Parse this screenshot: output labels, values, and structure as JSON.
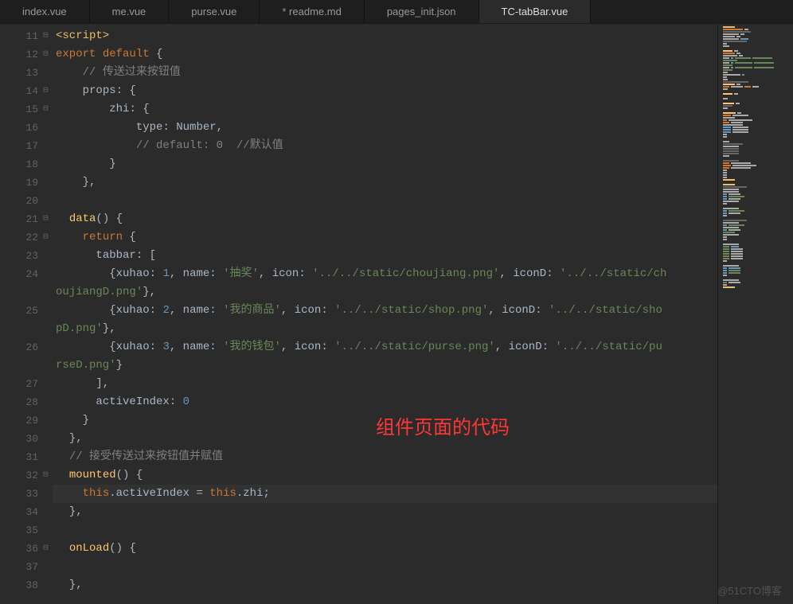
{
  "tabs": [
    {
      "label": "index.vue",
      "active": false
    },
    {
      "label": "me.vue",
      "active": false
    },
    {
      "label": "purse.vue",
      "active": false
    },
    {
      "label": "* readme.md",
      "active": false
    },
    {
      "label": "pages_init.json",
      "active": false
    },
    {
      "label": "TC-tabBar.vue",
      "active": true
    }
  ],
  "lineStart": 11,
  "foldMarks": {
    "11": "⊟",
    "12": "⊟",
    "14": "⊟",
    "15": "⊟",
    "21": "⊟",
    "22": "⊟",
    "32": "⊟",
    "36": "⊟"
  },
  "highlightLine": 33,
  "overlayText": "组件页面的代码",
  "watermark": "@51CTO博客",
  "code": [
    [
      [
        "tag",
        "<script>"
      ]
    ],
    [
      [
        "kw",
        "export"
      ],
      [
        "op",
        " "
      ],
      [
        "kw",
        "default"
      ],
      [
        "op",
        " {"
      ]
    ],
    [
      [
        "op",
        "    "
      ],
      [
        "cm",
        "// 传送过来按钮值"
      ]
    ],
    [
      [
        "op",
        "    "
      ],
      [
        "id",
        "props"
      ],
      [
        "op",
        ": {"
      ]
    ],
    [
      [
        "op",
        "        "
      ],
      [
        "id",
        "zhi"
      ],
      [
        "op",
        ": {"
      ]
    ],
    [
      [
        "op",
        "            "
      ],
      [
        "id",
        "type"
      ],
      [
        "op",
        ": "
      ],
      [
        "id",
        "Number"
      ],
      [
        "op",
        ","
      ]
    ],
    [
      [
        "op",
        "            "
      ],
      [
        "cm",
        "// default: 0  //默认值"
      ]
    ],
    [
      [
        "op",
        "        }"
      ]
    ],
    [
      [
        "op",
        "    },"
      ]
    ],
    [],
    [
      [
        "op",
        "  "
      ],
      [
        "fn",
        "data"
      ],
      [
        "op",
        "() {"
      ]
    ],
    [
      [
        "op",
        "    "
      ],
      [
        "kw",
        "return"
      ],
      [
        "op",
        " {"
      ]
    ],
    [
      [
        "op",
        "      "
      ],
      [
        "id",
        "tabbar"
      ],
      [
        "op",
        ": ["
      ]
    ],
    [
      [
        "op",
        "        {"
      ],
      [
        "id",
        "xuhao"
      ],
      [
        "op",
        ": "
      ],
      [
        "num",
        "1"
      ],
      [
        "op",
        ", "
      ],
      [
        "id",
        "name"
      ],
      [
        "op",
        ": "
      ],
      [
        "str",
        "'抽奖'"
      ],
      [
        "op",
        ", "
      ],
      [
        "id",
        "icon"
      ],
      [
        "op",
        ": "
      ],
      [
        "str",
        "'../../static/choujiang.png'"
      ],
      [
        "op",
        ", "
      ],
      [
        "id",
        "iconD"
      ],
      [
        "op",
        ": "
      ],
      [
        "str",
        "'../../static/ch"
      ]
    ],
    [
      [
        "str",
        "oujiangD.png'"
      ],
      [
        "op",
        "},"
      ]
    ],
    [
      [
        "op",
        "        {"
      ],
      [
        "id",
        "xuhao"
      ],
      [
        "op",
        ": "
      ],
      [
        "num",
        "2"
      ],
      [
        "op",
        ", "
      ],
      [
        "id",
        "name"
      ],
      [
        "op",
        ": "
      ],
      [
        "str",
        "'我的商品'"
      ],
      [
        "op",
        ", "
      ],
      [
        "id",
        "icon"
      ],
      [
        "op",
        ": "
      ],
      [
        "str",
        "'../../static/shop.png'"
      ],
      [
        "op",
        ", "
      ],
      [
        "id",
        "iconD"
      ],
      [
        "op",
        ": "
      ],
      [
        "str",
        "'../../static/sho"
      ]
    ],
    [
      [
        "str",
        "pD.png'"
      ],
      [
        "op",
        "},"
      ]
    ],
    [
      [
        "op",
        "        {"
      ],
      [
        "id",
        "xuhao"
      ],
      [
        "op",
        ": "
      ],
      [
        "num",
        "3"
      ],
      [
        "op",
        ", "
      ],
      [
        "id",
        "name"
      ],
      [
        "op",
        ": "
      ],
      [
        "str",
        "'我的钱包'"
      ],
      [
        "op",
        ", "
      ],
      [
        "id",
        "icon"
      ],
      [
        "op",
        ": "
      ],
      [
        "str",
        "'../../static/purse.png'"
      ],
      [
        "op",
        ", "
      ],
      [
        "id",
        "iconD"
      ],
      [
        "op",
        ": "
      ],
      [
        "str",
        "'../../static/pu"
      ]
    ],
    [
      [
        "str",
        "rseD.png'"
      ],
      [
        "op",
        "}"
      ]
    ],
    [
      [
        "op",
        "      ],"
      ]
    ],
    [
      [
        "op",
        "      "
      ],
      [
        "id",
        "activeIndex"
      ],
      [
        "op",
        ": "
      ],
      [
        "num",
        "0"
      ]
    ],
    [
      [
        "op",
        "    }"
      ]
    ],
    [
      [
        "op",
        "  },"
      ]
    ],
    [
      [
        "op",
        "  "
      ],
      [
        "cm",
        "// 接受传送过来按钮值并赋值"
      ]
    ],
    [
      [
        "op",
        "  "
      ],
      [
        "fn",
        "mounted"
      ],
      [
        "op",
        "() {"
      ]
    ],
    [
      [
        "op",
        "    "
      ],
      [
        "kw",
        "this"
      ],
      [
        "op",
        "."
      ],
      [
        "id",
        "activeIndex"
      ],
      [
        "op",
        " = "
      ],
      [
        "kw",
        "this"
      ],
      [
        "op",
        "."
      ],
      [
        "id",
        "zhi"
      ],
      [
        "op",
        ";"
      ]
    ],
    [
      [
        "op",
        "  },"
      ]
    ],
    [],
    [
      [
        "op",
        "  "
      ],
      [
        "fn",
        "onLoad"
      ],
      [
        "op",
        "() {"
      ]
    ],
    [],
    [
      [
        "op",
        "  },"
      ]
    ]
  ],
  "displayLineNumbers": [
    11,
    12,
    13,
    14,
    15,
    16,
    17,
    18,
    19,
    20,
    21,
    22,
    23,
    24,
    null,
    25,
    null,
    26,
    null,
    27,
    28,
    29,
    30,
    31,
    32,
    33,
    34,
    35,
    36,
    37,
    38
  ],
  "minimapLines": [
    [
      [
        "#e8bf6a",
        15
      ]
    ],
    [
      [
        "#cc7832",
        25
      ],
      [
        "#aaa",
        5
      ]
    ],
    [
      [
        "#666",
        35
      ]
    ],
    [
      [
        "#aaa",
        20
      ],
      [
        "#aaa",
        5
      ]
    ],
    [
      [
        "#aaa",
        15
      ],
      [
        "#aaa",
        5
      ]
    ],
    [
      [
        "#aaa",
        20
      ],
      [
        "#6897bb",
        10
      ]
    ],
    [
      [
        "#666",
        30
      ]
    ],
    [
      [
        "#aaa",
        5
      ]
    ],
    [
      [
        "#aaa",
        8
      ]
    ],
    [],
    [
      [
        "#ffc66d",
        12
      ],
      [
        "#aaa",
        5
      ]
    ],
    [
      [
        "#cc7832",
        15
      ],
      [
        "#aaa",
        5
      ]
    ],
    [
      [
        "#aaa",
        18
      ],
      [
        "#aaa",
        5
      ]
    ],
    [
      [
        "#aaa",
        8
      ],
      [
        "#6897bb",
        3
      ],
      [
        "#6a8759",
        20
      ],
      [
        "#6a8759",
        25
      ]
    ],
    [
      [
        "#6a8759",
        18
      ]
    ],
    [
      [
        "#aaa",
        8
      ],
      [
        "#6897bb",
        3
      ],
      [
        "#6a8759",
        22
      ],
      [
        "#6a8759",
        25
      ]
    ],
    [
      [
        "#6a8759",
        12
      ]
    ],
    [
      [
        "#aaa",
        8
      ],
      [
        "#6897bb",
        3
      ],
      [
        "#6a8759",
        22
      ],
      [
        "#6a8759",
        25
      ]
    ],
    [
      [
        "#6a8759",
        12
      ]
    ],
    [
      [
        "#aaa",
        6
      ]
    ],
    [
      [
        "#aaa",
        22
      ],
      [
        "#6897bb",
        3
      ]
    ],
    [
      [
        "#aaa",
        5
      ]
    ],
    [
      [
        "#aaa",
        6
      ]
    ],
    [
      [
        "#666",
        32
      ]
    ],
    [
      [
        "#ffc66d",
        15
      ],
      [
        "#aaa",
        5
      ]
    ],
    [
      [
        "#cc7832",
        8
      ],
      [
        "#aaa",
        15
      ],
      [
        "#cc7832",
        8
      ],
      [
        "#aaa",
        8
      ]
    ],
    [
      [
        "#aaa",
        6
      ]
    ],
    [],
    [
      [
        "#ffc66d",
        12
      ],
      [
        "#aaa",
        5
      ]
    ],
    [],
    [
      [
        "#aaa",
        6
      ]
    ],
    [],
    [
      [
        "#ffc66d",
        14
      ],
      [
        "#aaa",
        5
      ]
    ],
    [
      [
        "#666",
        12
      ]
    ],
    [
      [
        "#aaa",
        6
      ]
    ],
    [],
    [
      [
        "#ffc66d",
        16
      ],
      [
        "#aaa",
        5
      ]
    ],
    [
      [
        "#cc7832",
        10
      ],
      [
        "#aaa",
        20
      ]
    ],
    [
      [
        "#aaa",
        15
      ]
    ],
    [
      [
        "#cc7832",
        5
      ],
      [
        "#aaa",
        30
      ]
    ],
    [
      [
        "#cc7832",
        8
      ],
      [
        "#aaa",
        15
      ]
    ],
    [
      [
        "#aaa",
        25
      ]
    ],
    [
      [
        "#6897bb",
        10
      ],
      [
        "#aaa",
        20
      ]
    ],
    [
      [
        "#6897bb",
        10
      ],
      [
        "#aaa",
        20
      ]
    ],
    [
      [
        "#6897bb",
        10
      ],
      [
        "#aaa",
        20
      ]
    ],
    [
      [
        "#aaa",
        5
      ]
    ],
    [
      [
        "#aaa",
        5
      ]
    ],
    [],
    [
      [
        "#aaa",
        8
      ]
    ],
    [
      [
        "#666",
        25
      ]
    ],
    [
      [
        "#aaa",
        20
      ]
    ],
    [
      [
        "#666",
        20
      ]
    ],
    [
      [
        "#666",
        20
      ]
    ],
    [
      [
        "#666",
        20
      ]
    ],
    [
      [
        "#aaa",
        8
      ]
    ],
    [],
    [
      [
        "#666",
        20
      ]
    ],
    [
      [
        "#cc7832",
        8
      ],
      [
        "#aaa",
        25
      ]
    ],
    [
      [
        "#cc7832",
        10
      ],
      [
        "#aaa",
        30
      ]
    ],
    [
      [
        "#cc7832",
        8
      ],
      [
        "#aaa",
        25
      ]
    ],
    [
      [
        "#aaa",
        5
      ]
    ],
    [
      [
        "#aaa",
        5
      ]
    ],
    [
      [
        "#aaa",
        5
      ]
    ],
    [
      [
        "#aaa",
        5
      ]
    ],
    [
      [
        "#e8bf6a",
        15
      ]
    ],
    [],
    [
      [
        "#e8bf6a",
        15
      ]
    ],
    [
      [
        "#666",
        30
      ]
    ],
    [
      [
        "#aaa",
        20
      ]
    ],
    [
      [
        "#aaa",
        20
      ]
    ],
    [
      [
        "#6897bb",
        5
      ],
      [
        "#aaa",
        15
      ]
    ],
    [
      [
        "#6897bb",
        5
      ],
      [
        "#6a8759",
        20
      ]
    ],
    [
      [
        "#6897bb",
        5
      ],
      [
        "#aaa",
        15
      ]
    ],
    [
      [
        "#aaa",
        20
      ]
    ],
    [
      [
        "#aaa",
        5
      ]
    ],
    [],
    [
      [
        "#aaa",
        20
      ]
    ],
    [
      [
        "#6897bb",
        5
      ],
      [
        "#6a8759",
        20
      ]
    ],
    [
      [
        "#6897bb",
        5
      ],
      [
        "#aaa",
        15
      ]
    ],
    [
      [
        "#aaa",
        5
      ]
    ],
    [],
    [
      [
        "#666",
        30
      ]
    ],
    [
      [
        "#aaa",
        20
      ]
    ],
    [
      [
        "#6897bb",
        5
      ],
      [
        "#6a8759",
        20
      ]
    ],
    [
      [
        "#aaa",
        20
      ]
    ],
    [
      [
        "#6897bb",
        5
      ],
      [
        "#aaa",
        15
      ]
    ],
    [
      [
        "#6a8759",
        15
      ]
    ],
    [
      [
        "#aaa",
        20
      ]
    ],
    [
      [
        "#aaa",
        5
      ]
    ],
    [
      [
        "#aaa",
        5
      ]
    ],
    [],
    [
      [
        "#aaa",
        20
      ]
    ],
    [
      [
        "#6a8759",
        8
      ],
      [
        "#6897bb",
        10
      ]
    ],
    [
      [
        "#6a8759",
        8
      ],
      [
        "#aaa",
        15
      ]
    ],
    [
      [
        "#6a8759",
        8
      ],
      [
        "#aaa",
        15
      ]
    ],
    [
      [
        "#6a8759",
        8
      ],
      [
        "#aaa",
        15
      ]
    ],
    [
      [
        "#6a8759",
        8
      ],
      [
        "#aaa",
        15
      ]
    ],
    [
      [
        "#6a8759",
        8
      ],
      [
        "#aaa",
        15
      ]
    ],
    [
      [
        "#aaa",
        5
      ]
    ],
    [],
    [
      [
        "#aaa",
        20
      ]
    ],
    [
      [
        "#6897bb",
        5
      ],
      [
        "#6897bb",
        15
      ]
    ],
    [
      [
        "#6897bb",
        5
      ],
      [
        "#6a8759",
        15
      ]
    ],
    [
      [
        "#6897bb",
        5
      ],
      [
        "#6a8759",
        15
      ]
    ],
    [
      [
        "#aaa",
        5
      ]
    ],
    [],
    [
      [
        "#aaa",
        20
      ]
    ],
    [
      [
        "#6a8759",
        5
      ],
      [
        "#aaa",
        15
      ]
    ],
    [
      [
        "#aaa",
        5
      ]
    ],
    [
      [
        "#e8bf6a",
        15
      ]
    ]
  ]
}
